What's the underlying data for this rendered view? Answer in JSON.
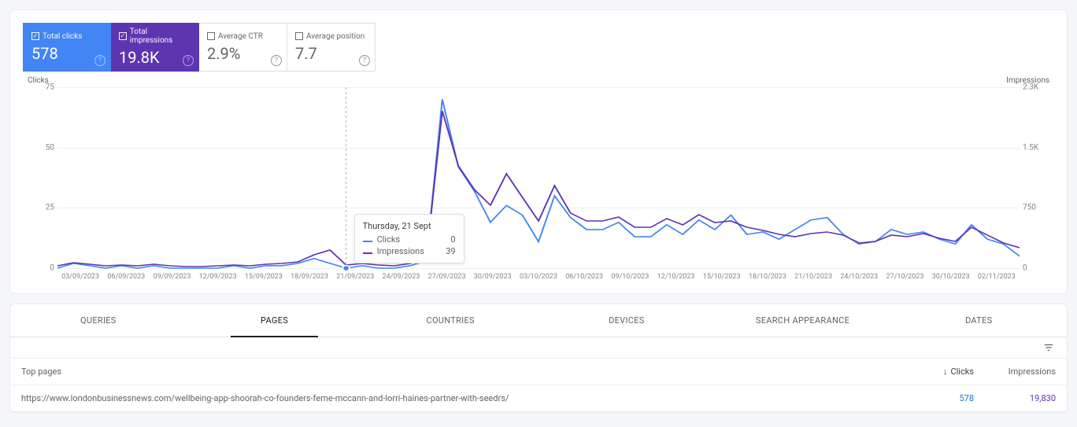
{
  "colors": {
    "clicks": "#4285f4",
    "impressions": "#5e35b1"
  },
  "kpis": {
    "clicks": {
      "label": "Total clicks",
      "value": "578",
      "checked": true
    },
    "impressions": {
      "label": "Total impressions",
      "value": "19.8K",
      "checked": true
    },
    "ctr": {
      "label": "Average CTR",
      "value": "2.9%",
      "checked": false
    },
    "position": {
      "label": "Average position",
      "value": "7.7",
      "checked": false
    }
  },
  "chart_axes": {
    "left": {
      "title": "Clicks",
      "ticks": [
        "0",
        "25",
        "50",
        "75"
      ],
      "max": 75
    },
    "right": {
      "title": "Impressions",
      "ticks": [
        "0",
        "750",
        "1.5K",
        "2.3K"
      ],
      "max": 2300
    }
  },
  "x_ticks": [
    "03/09/2023",
    "06/09/2023",
    "09/09/2023",
    "12/09/2023",
    "15/09/2023",
    "18/09/2023",
    "21/09/2023",
    "24/09/2023",
    "27/09/2023",
    "30/09/2023",
    "03/10/2023",
    "06/10/2023",
    "09/10/2023",
    "12/10/2023",
    "15/10/2023",
    "18/10/2023",
    "21/10/2023",
    "24/10/2023",
    "27/10/2023",
    "30/10/2023",
    "02/11/2023"
  ],
  "tooltip": {
    "date": "Thursday, 21 Sept",
    "clicks_label": "Clicks",
    "clicks_value": "0",
    "impr_label": "Impressions",
    "impr_value": "39"
  },
  "tabs": {
    "queries": "QUERIES",
    "pages": "PAGES",
    "countries": "COUNTRIES",
    "devices": "DEVICES",
    "appearance": "SEARCH APPEARANCE",
    "dates": "DATES",
    "active": "pages"
  },
  "table": {
    "header": {
      "page": "Top pages",
      "clicks": "Clicks",
      "impressions": "Impressions"
    },
    "rows": [
      {
        "page": "https://www.londonbusinessnews.com/wellbeing-app-shoorah-co-founders-ferne-mccann-and-lorri-haines-partner-with-seedrs/",
        "clicks": "578",
        "impressions": "19,830"
      }
    ]
  },
  "chart_data": {
    "type": "line",
    "xlabel": "",
    "ylabel_left": "Clicks",
    "ylabel_right": "Impressions",
    "ylim_left": [
      0,
      75
    ],
    "ylim_right": [
      0,
      2300
    ],
    "x": [
      "03/09",
      "04/09",
      "05/09",
      "06/09",
      "07/09",
      "08/09",
      "09/09",
      "10/09",
      "11/09",
      "12/09",
      "13/09",
      "14/09",
      "15/09",
      "16/09",
      "17/09",
      "18/09",
      "19/09",
      "20/09",
      "21/09",
      "22/09",
      "23/09",
      "24/09",
      "25/09",
      "26/09",
      "27/09",
      "28/09",
      "29/09",
      "30/09",
      "01/10",
      "02/10",
      "03/10",
      "04/10",
      "05/10",
      "06/10",
      "07/10",
      "08/10",
      "09/10",
      "10/10",
      "11/10",
      "12/10",
      "13/10",
      "14/10",
      "15/10",
      "16/10",
      "17/10",
      "18/10",
      "19/10",
      "20/10",
      "21/10",
      "22/10",
      "23/10",
      "24/10",
      "25/10",
      "26/10",
      "27/10",
      "28/10",
      "29/10",
      "30/10",
      "31/10",
      "01/11",
      "02/11"
    ],
    "series": [
      {
        "name": "Clicks",
        "axis": "left",
        "color": "#4285f4",
        "values": [
          0,
          2,
          1,
          0,
          1,
          0,
          1,
          0,
          0,
          0,
          0,
          1,
          0,
          1,
          1,
          2,
          4,
          2,
          0,
          1,
          0,
          0,
          1,
          3,
          70,
          42,
          32,
          19,
          26,
          22,
          11,
          30,
          21,
          16,
          16,
          19,
          13,
          13,
          18,
          14,
          20,
          16,
          22,
          14,
          15,
          12,
          16,
          20,
          21,
          14,
          10,
          11,
          16,
          14,
          15,
          12,
          10,
          18,
          12,
          10,
          5
        ]
      },
      {
        "name": "Impressions",
        "axis": "right",
        "color": "#5e35b1",
        "values": [
          30,
          70,
          50,
          30,
          40,
          30,
          50,
          30,
          20,
          20,
          30,
          40,
          30,
          50,
          60,
          80,
          170,
          230,
          39,
          60,
          40,
          30,
          60,
          120,
          2000,
          1300,
          1000,
          800,
          1200,
          900,
          600,
          1050,
          700,
          600,
          600,
          650,
          520,
          520,
          630,
          550,
          680,
          580,
          600,
          520,
          480,
          430,
          400,
          440,
          460,
          420,
          320,
          340,
          420,
          400,
          440,
          380,
          340,
          520,
          420,
          320,
          260
        ]
      }
    ]
  }
}
